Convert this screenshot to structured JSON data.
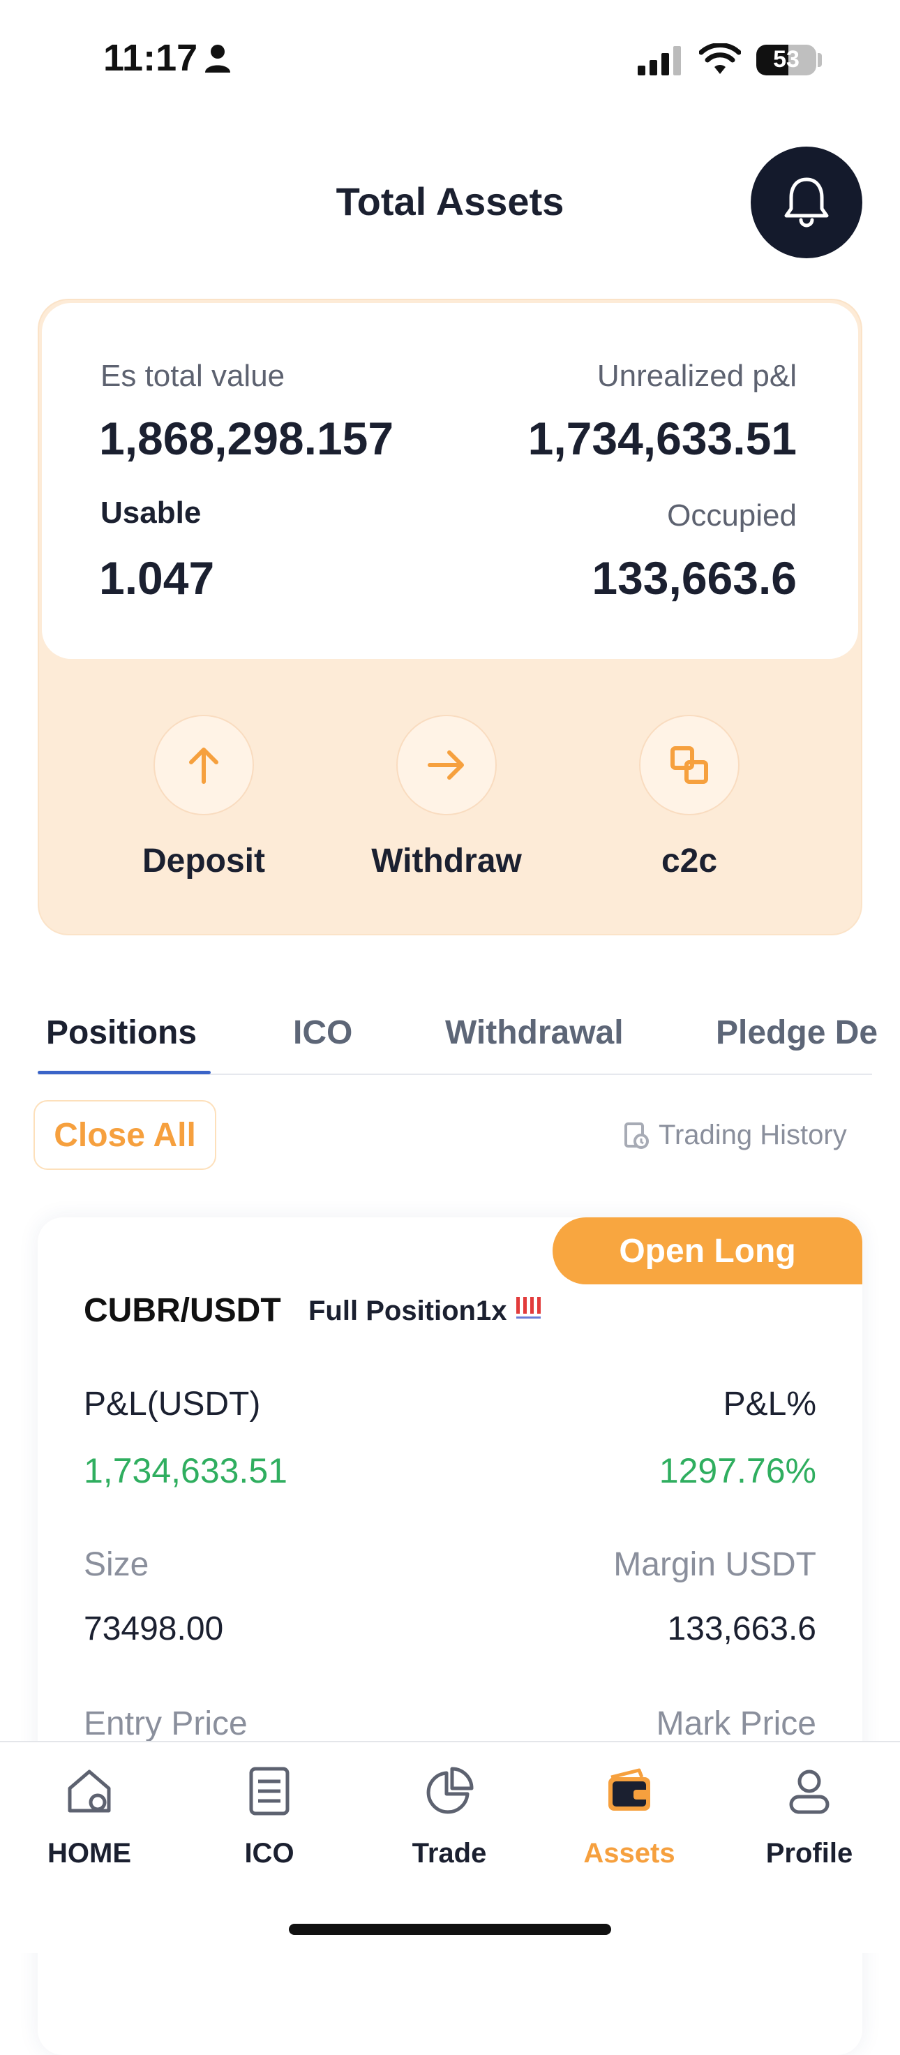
{
  "status_bar": {
    "time": "11:17",
    "battery": "53",
    "battery_level": 0.53
  },
  "header": {
    "title": "Total Assets"
  },
  "summary": {
    "es_total_label": "Es total value",
    "es_total_value": "1,868,298.157",
    "unrealized_label": "Unrealized p&l",
    "unrealized_value": "1,734,633.51",
    "usable_label": "Usable",
    "usable_value": "1.047",
    "occupied_label": "Occupied",
    "occupied_value": "133,663.6",
    "actions": [
      {
        "label": "Deposit",
        "icon": "arrow-up-icon"
      },
      {
        "label": "Withdraw",
        "icon": "arrow-right-icon"
      },
      {
        "label": "c2c",
        "icon": "exchange-icon"
      }
    ]
  },
  "tabs": [
    {
      "label": "Positions",
      "active": true
    },
    {
      "label": "ICO"
    },
    {
      "label": "Withdrawal"
    },
    {
      "label": "Pledge De"
    }
  ],
  "toolbar": {
    "close_all": "Close All",
    "trading_history": "Trading History"
  },
  "position": {
    "badge": "Open Long",
    "pair": "CUBR/USDT",
    "type": "Full Position1x",
    "pnl_label": "P&L(USDT)",
    "pnl_value": "1,734,633.51",
    "pnl_pct_label": "P&L%",
    "pnl_pct_value": "1297.76%",
    "size_label": "Size",
    "size_value": "73498.00",
    "margin_label": "Margin USDT",
    "margin_value": "133,663.6",
    "entry_label": "Entry Price",
    "mark_label": "Mark Price"
  },
  "nav": [
    {
      "label": "HOME",
      "icon": "home-icon"
    },
    {
      "label": "ICO",
      "icon": "document-icon"
    },
    {
      "label": "Trade",
      "icon": "pie-chart-icon"
    },
    {
      "label": "Assets",
      "icon": "wallet-icon",
      "active": true
    },
    {
      "label": "Profile",
      "icon": "user-icon"
    }
  ],
  "colors": {
    "accent": "#f6a03e",
    "positive": "#2fae5f",
    "dark": "#141a2c"
  }
}
